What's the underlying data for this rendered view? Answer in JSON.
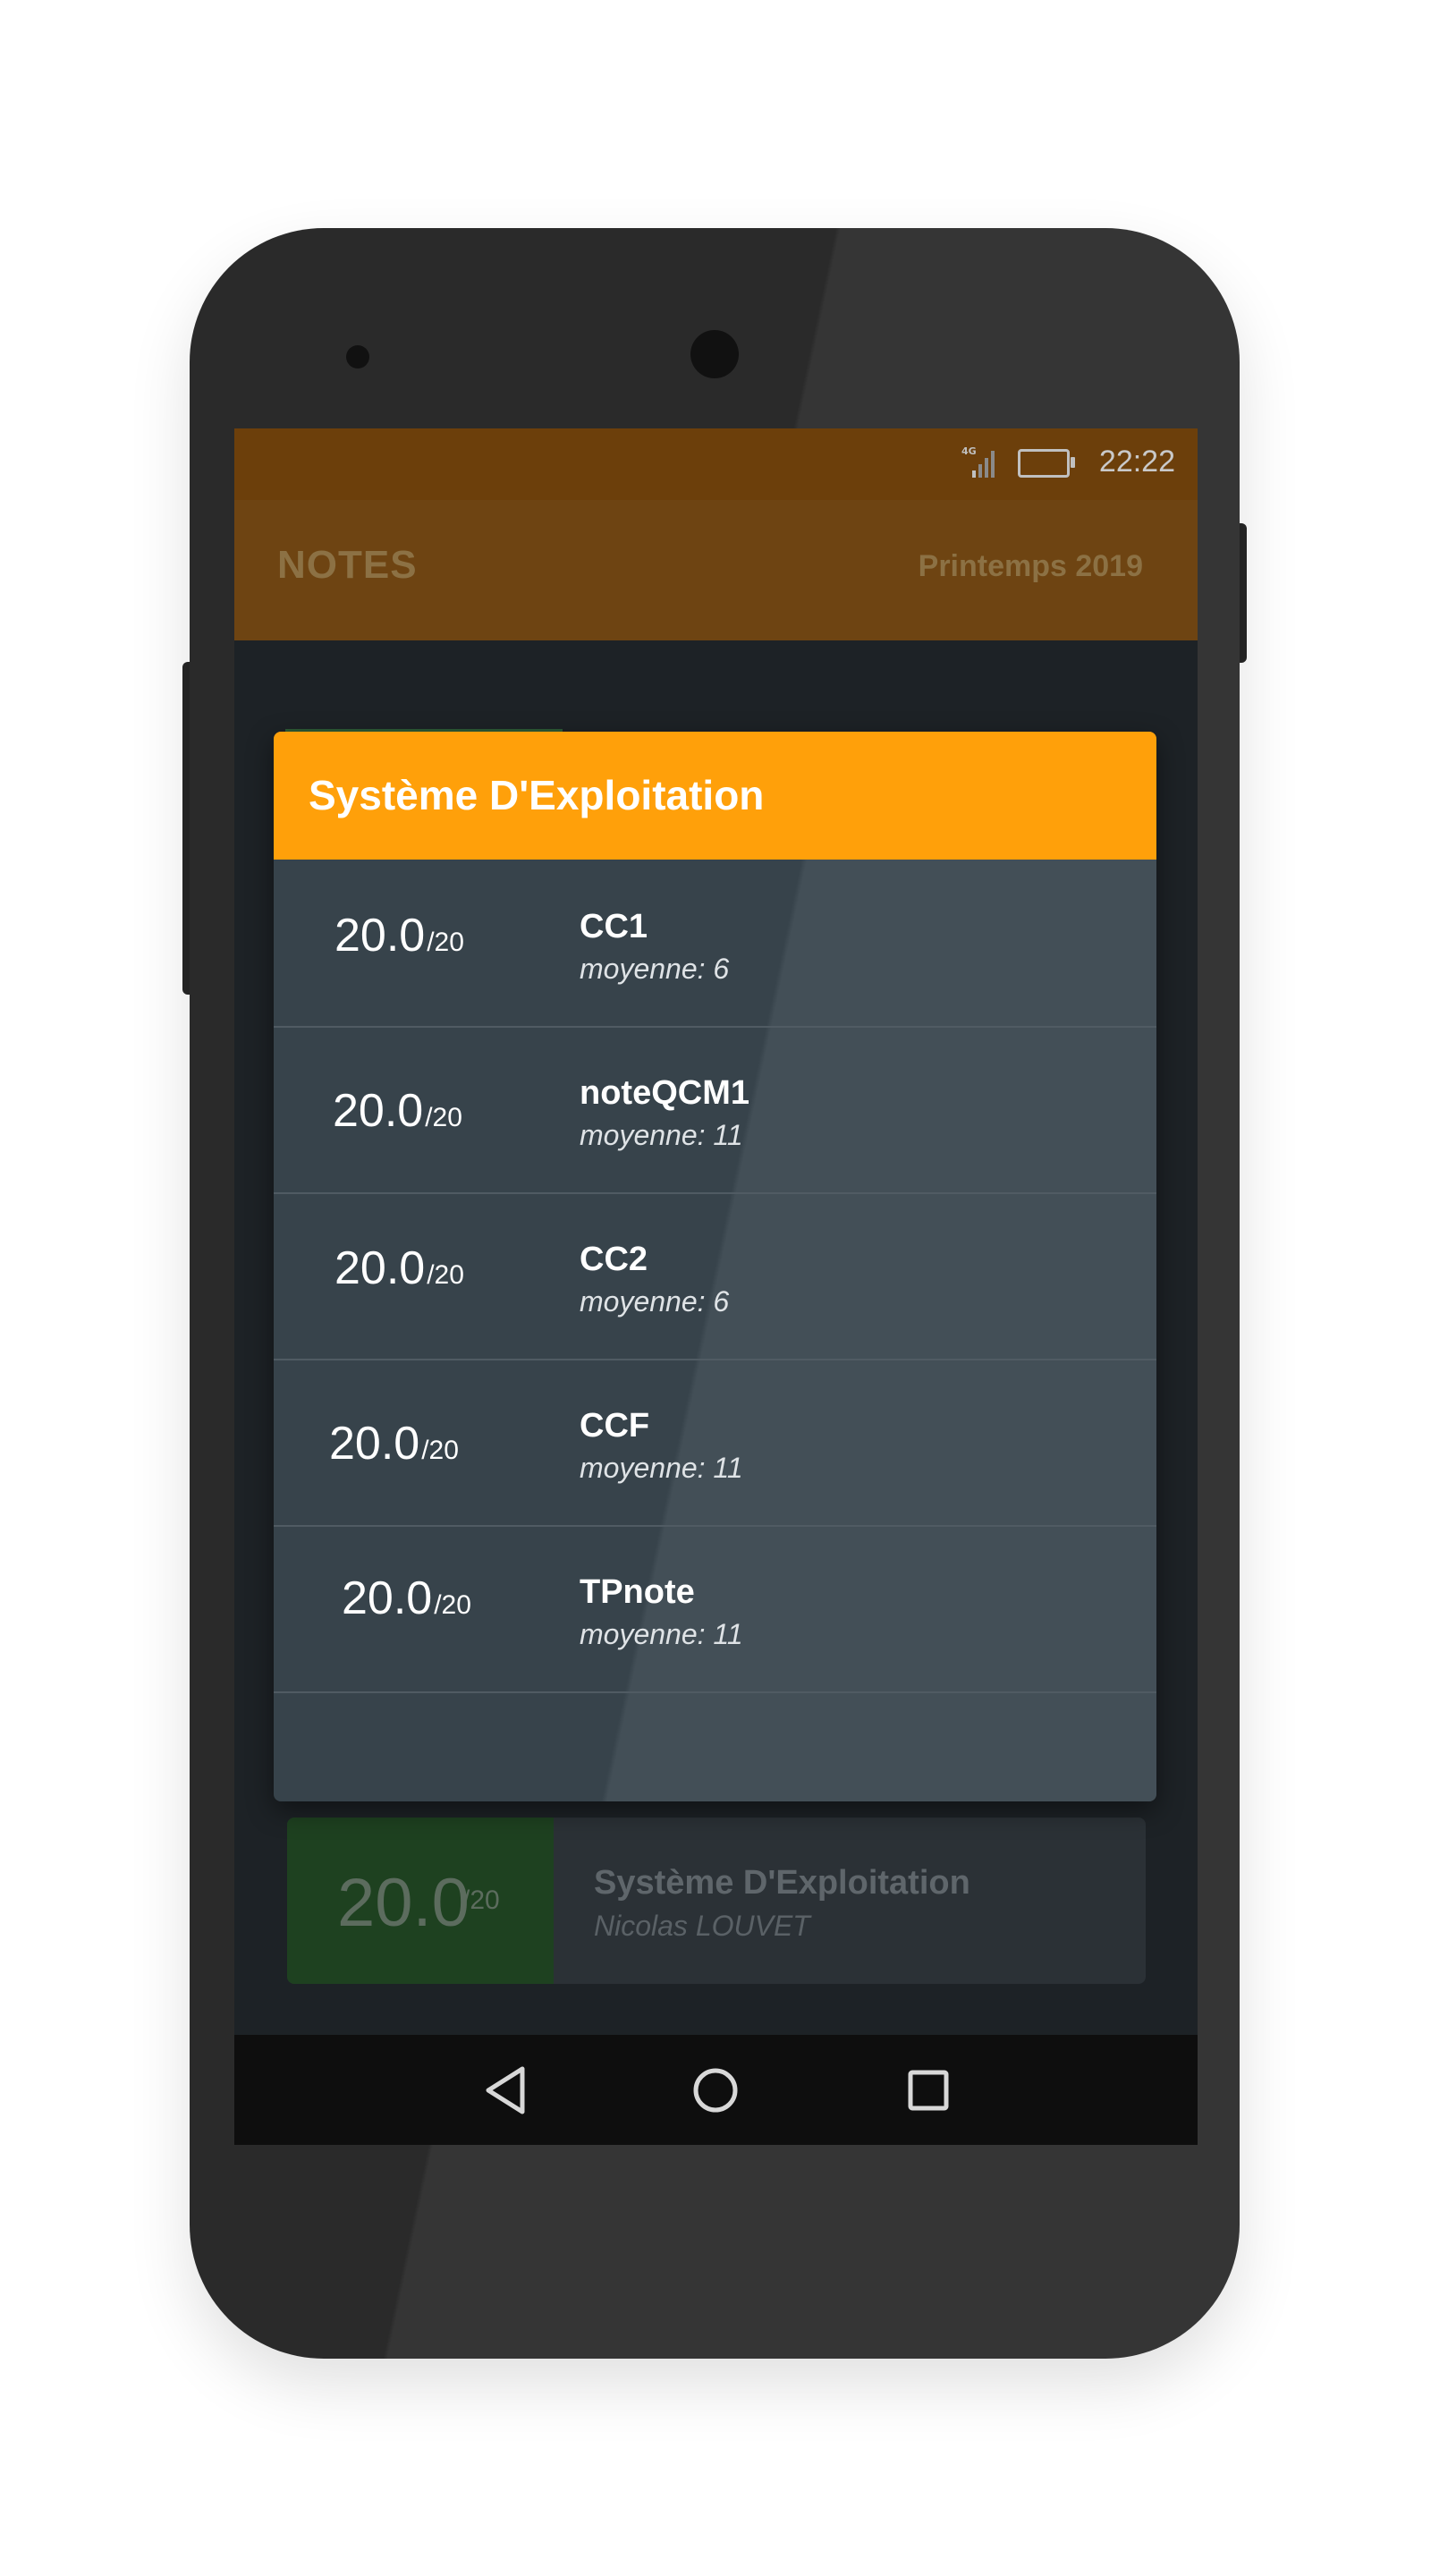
{
  "status_bar": {
    "time": "22:22",
    "network": "4G",
    "icons": [
      "signal-icon",
      "battery-icon"
    ]
  },
  "app_bar": {
    "title": "NOTES",
    "semester": "Printemps 2019"
  },
  "dialog": {
    "title": "Système D'Exploitation",
    "rows": [
      {
        "grade": "20.0",
        "out_of": "/20",
        "name": "CC1",
        "average": "moyenne: 6"
      },
      {
        "grade": "20.0",
        "out_of": "/20",
        "name": "noteQCM1",
        "average": "moyenne: 11"
      },
      {
        "grade": "20.0",
        "out_of": "/20",
        "name": "CC2",
        "average": "moyenne: 6"
      },
      {
        "grade": "20.0",
        "out_of": "/20",
        "name": "CCF",
        "average": "moyenne: 11"
      },
      {
        "grade": "20.0",
        "out_of": "/20",
        "name": "TPnote",
        "average": "moyenne: 11"
      }
    ],
    "header_color": "#ffa00a"
  },
  "background_card": {
    "grade": "20.0",
    "out_of": "/20",
    "course": "Système D'Exploitation",
    "teacher": "Nicolas LOUVET",
    "grade_color": "#1e4120"
  },
  "nav_bar": {
    "icons": [
      "back-icon",
      "home-icon",
      "recents-icon"
    ]
  },
  "colors": {
    "accent": "#ffa00a",
    "status_bar": "#6c3f0b",
    "screen_background": "#1d2226"
  }
}
